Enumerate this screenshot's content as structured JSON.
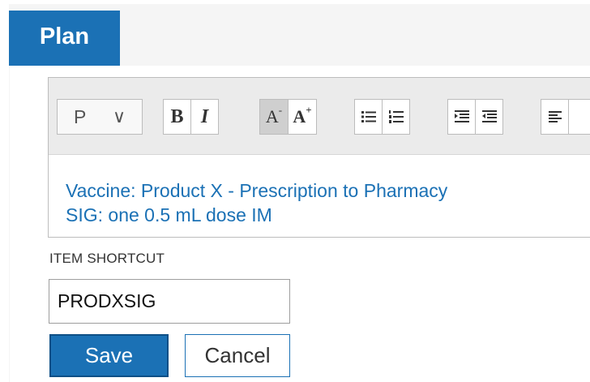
{
  "section": {
    "title": "Plan"
  },
  "toolbar": {
    "format": {
      "value": "P",
      "chevron": "∨"
    },
    "bold_label": "B",
    "italic_label": "I",
    "font_decrease_label": "A",
    "font_decrease_sup": "-",
    "font_increase_label": "A",
    "font_increase_sup": "+",
    "icons": [
      "bullet-list-icon",
      "numbered-list-icon",
      "indent-icon",
      "outdent-icon",
      "align-left-icon"
    ]
  },
  "editor": {
    "lines": [
      "Vaccine: Product X - Prescription to Pharmacy",
      "SIG: one 0.5 mL dose IM"
    ]
  },
  "shortcut": {
    "label": "ITEM SHORTCUT",
    "value": "PRODXSIG"
  },
  "actions": {
    "save_label": "Save",
    "cancel_label": "Cancel"
  },
  "colors": {
    "accent": "#1b71b5",
    "panel_bg": "#f5f5f5",
    "toolbar_bg": "#ebebeb"
  }
}
